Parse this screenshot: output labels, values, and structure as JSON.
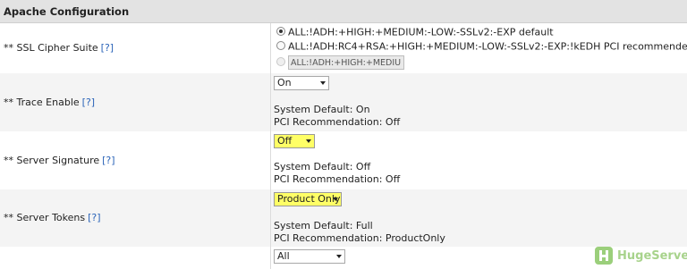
{
  "section": {
    "title": "Apache Configuration"
  },
  "help_label": "[?]",
  "rows": {
    "ssl_cipher": {
      "label": "** SSL Cipher Suite",
      "options": [
        {
          "label": "ALL:!ADH:+HIGH:+MEDIUM:-LOW:-SSLv2:-EXP default",
          "checked": true
        },
        {
          "label": "ALL:!ADH:RC4+RSA:+HIGH:+MEDIUM:-LOW:-SSLv2:-EXP:!kEDH PCI recommended",
          "checked": false
        },
        {
          "label": "",
          "checked": false
        }
      ],
      "custom_value": "ALL:!ADH:+HIGH:+MEDIU"
    },
    "trace_enable": {
      "label": "** Trace Enable",
      "selected": "On",
      "system_default": "System Default: On",
      "pci_recommendation": "PCI Recommendation: Off"
    },
    "server_signature": {
      "label": "** Server Signature",
      "selected": "Off",
      "system_default": "System Default: Off",
      "pci_recommendation": "PCI Recommendation: Off"
    },
    "server_tokens": {
      "label": "** Server Tokens",
      "selected": "Product Only",
      "system_default": "System Default: Full",
      "pci_recommendation": "PCI Recommendation: ProductOnly"
    },
    "next_row": {
      "selected": "All"
    }
  },
  "watermark": {
    "brand": "HugeServer"
  },
  "colors": {
    "highlight": "#ffff66",
    "link": "#2a63b8",
    "header_bg": "#e3e3e3"
  }
}
